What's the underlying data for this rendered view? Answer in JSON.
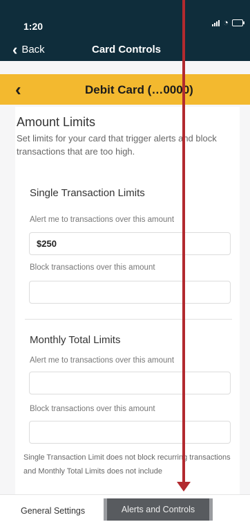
{
  "status_bar": {
    "time": "1:20"
  },
  "nav": {
    "back_label": "Back",
    "title": "Card Controls"
  },
  "card_header": {
    "title": "Debit Card (…0000)"
  },
  "amount_limits": {
    "title": "Amount Limits",
    "description": "Set limits for your card that trigger alerts and block transactions that are too high."
  },
  "single_transaction": {
    "title": "Single Transaction Limits",
    "alert_label": "Alert me to transactions over this amount",
    "alert_value": "$250",
    "block_label": "Block transactions over this amount",
    "block_value": ""
  },
  "monthly_total": {
    "title": "Monthly Total Limits",
    "alert_label": "Alert me to transactions over this amount",
    "alert_value": "",
    "block_label": "Block transactions over this amount",
    "block_value": ""
  },
  "footnote": "Single Transaction Limit does not block recurring transactions and Monthly Total Limits does not include",
  "tabs": {
    "general": "General Settings",
    "alerts": "Alerts and Controls"
  },
  "icons": {
    "back": "chevron-left-icon",
    "signal": "signal-icon",
    "wifi": "wifi-icon",
    "battery": "battery-icon",
    "annotation": "red-arrow"
  },
  "colors": {
    "header": "#0f2d3b",
    "accent": "#f3b92f",
    "annotation": "#b22a2f",
    "active_tab": "#585b5f"
  }
}
